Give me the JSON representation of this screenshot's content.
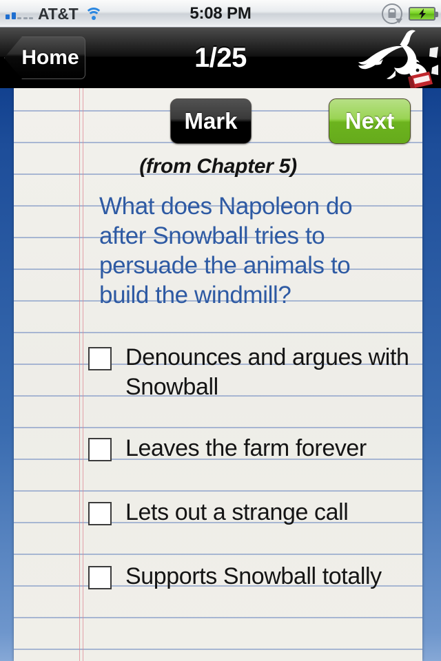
{
  "status_bar": {
    "signal_bars_filled": 2,
    "signal_bars_total": 5,
    "carrier": "AT&T",
    "wifi_icon": "wifi-icon",
    "time": "5:08 PM",
    "rotation_lock_icon": "rotation-lock-icon",
    "battery_icon": "battery-charging-icon",
    "battery_color": "#74d11f"
  },
  "nav_bar": {
    "back_label": "Home",
    "title": "1/25",
    "logo_icon": "sparknotes-dog-logo",
    "logo_book_color": "#c1272d",
    "background_color": "#000000"
  },
  "toolbar": {
    "mark_label": "Mark",
    "next_label": "Next",
    "next_color": "#7cc22c",
    "mark_color": "#000000"
  },
  "quiz": {
    "chapter_label": "(from Chapter 5)",
    "question": "What does Napoleon do after Snowball tries to persuade the animals to build the windmill?",
    "question_color": "#2e5aa3",
    "options": [
      {
        "label": "Denounces and argues with Snowball",
        "checked": false
      },
      {
        "label": "Leaves the farm forever",
        "checked": false
      },
      {
        "label": "Lets out a strange call",
        "checked": false
      },
      {
        "label": "Supports Snowball totally",
        "checked": false
      }
    ]
  },
  "paper": {
    "background_color": "#f0efe9",
    "rule_color": "#7a92c4",
    "margin_color": "#dd8692",
    "edge_color": "#1d4d99"
  }
}
